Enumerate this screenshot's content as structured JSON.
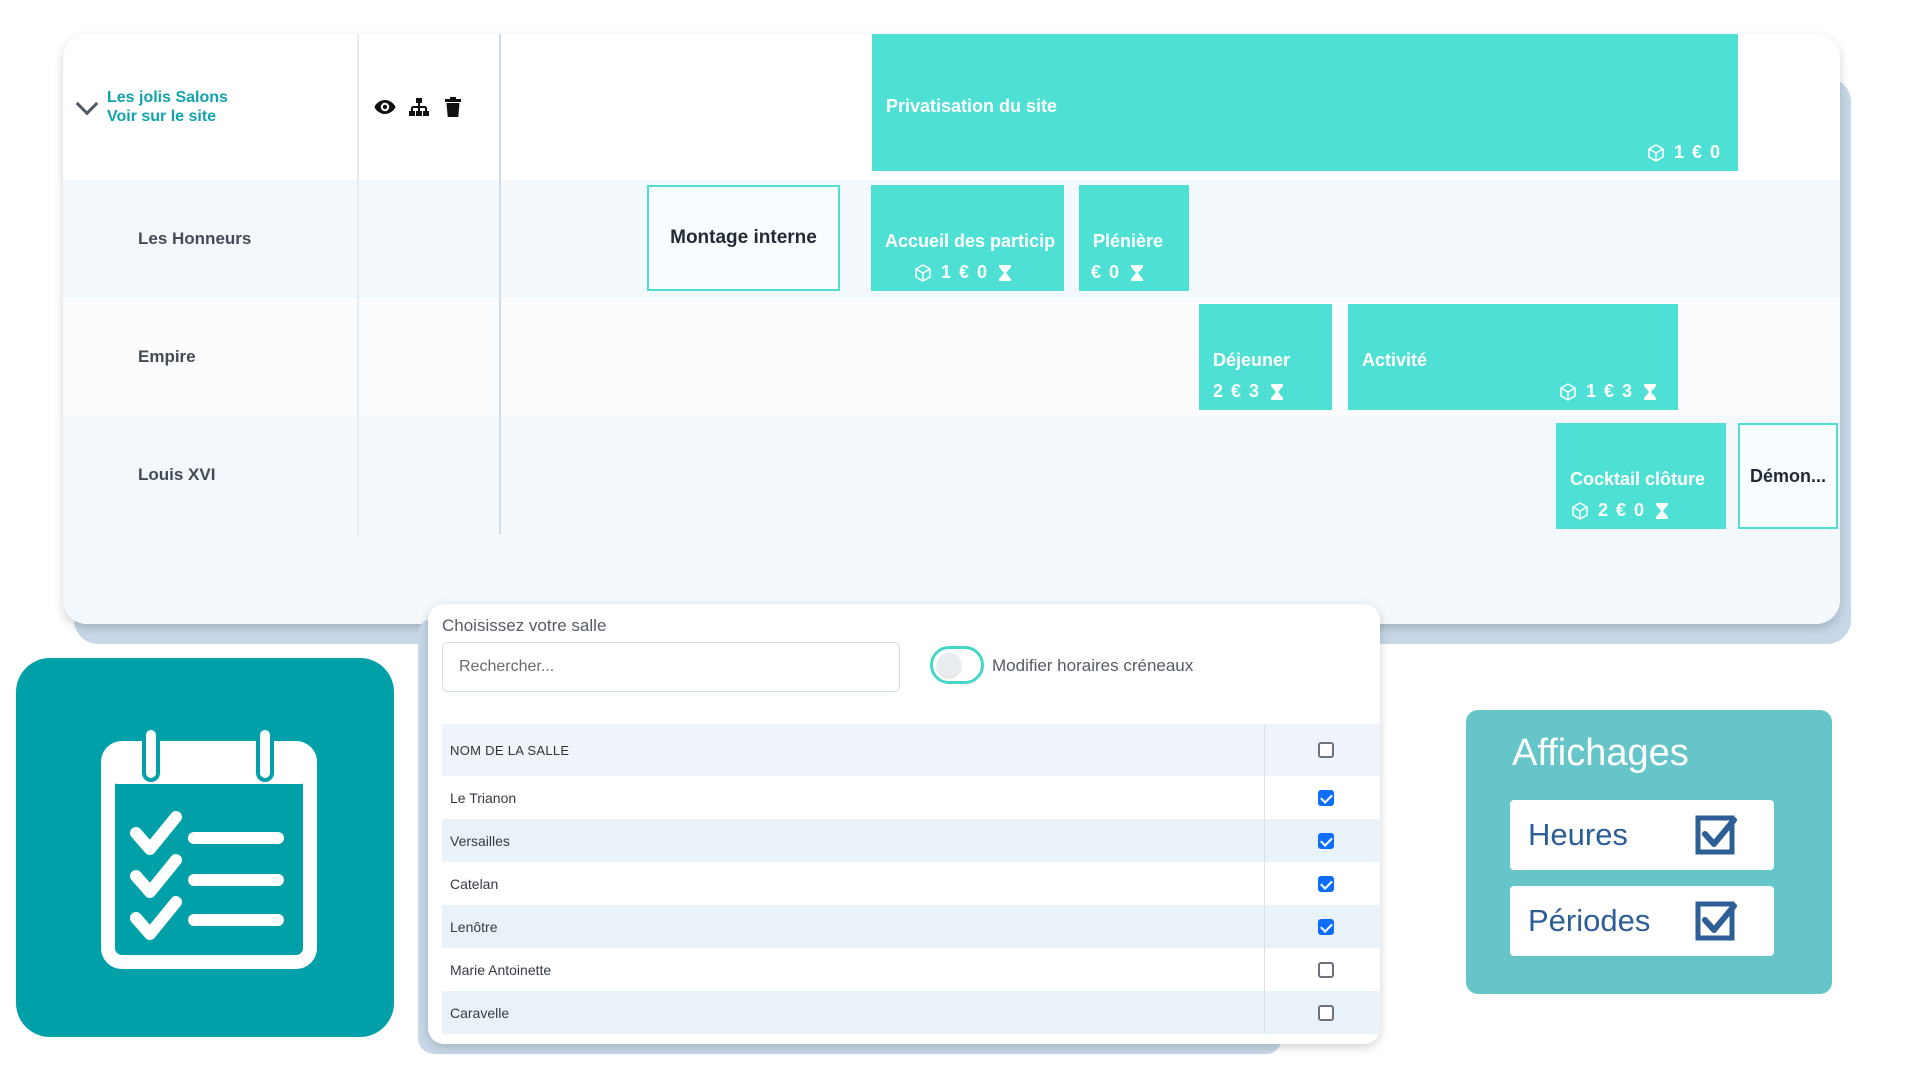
{
  "colors": {
    "event_fill": "#4ee0d4",
    "teal_brand": "#00a0a8",
    "site_link": "#10a3ae",
    "affichages_bg": "#66c5c9",
    "checkbox_blue": "#0d6efd",
    "check_navy": "#2d5e96"
  },
  "planning": {
    "site": {
      "title": "Les jolis Salons",
      "link": "Voir sur le site",
      "icons": [
        "eye-icon",
        "sitemap-icon",
        "trash-icon"
      ]
    },
    "rooms": [
      {
        "name": "Les Honneurs"
      },
      {
        "name": "Empire"
      },
      {
        "name": "Louis XVI"
      }
    ],
    "events": {
      "privatisation": {
        "title": "Privatisation du site",
        "qty": "1",
        "price": "0"
      },
      "montage": {
        "title": "Montage interne"
      },
      "accueil": {
        "title": "Accueil des particip",
        "qty": "1",
        "price": "0"
      },
      "pleniere": {
        "title": "Plénière",
        "price": "0"
      },
      "dejeuner": {
        "title": "Déjeuner",
        "qty": "2",
        "price": "3"
      },
      "activite": {
        "title": "Activité",
        "qty": "1",
        "price": "3"
      },
      "cocktail": {
        "title": "Cocktail clôture",
        "qty": "2",
        "price": "0"
      },
      "demon": {
        "title": "Démon..."
      }
    }
  },
  "room_selector": {
    "title": "Choisissez votre salle",
    "search_placeholder": "Rechercher...",
    "toggle_label": "Modifier horaires créneaux",
    "toggle_on": false,
    "column_header": "NOM DE LA SALLE",
    "rooms": [
      {
        "name": "Le Trianon",
        "checked": true
      },
      {
        "name": "Versailles",
        "checked": true
      },
      {
        "name": "Catelan",
        "checked": true
      },
      {
        "name": "Lenôtre",
        "checked": true
      },
      {
        "name": "Marie Antoinette",
        "checked": false
      },
      {
        "name": "Caravelle",
        "checked": false
      }
    ]
  },
  "affichages": {
    "title": "Affichages",
    "options": [
      {
        "label": "Heures",
        "checked": true
      },
      {
        "label": "Périodes",
        "checked": true
      }
    ]
  }
}
